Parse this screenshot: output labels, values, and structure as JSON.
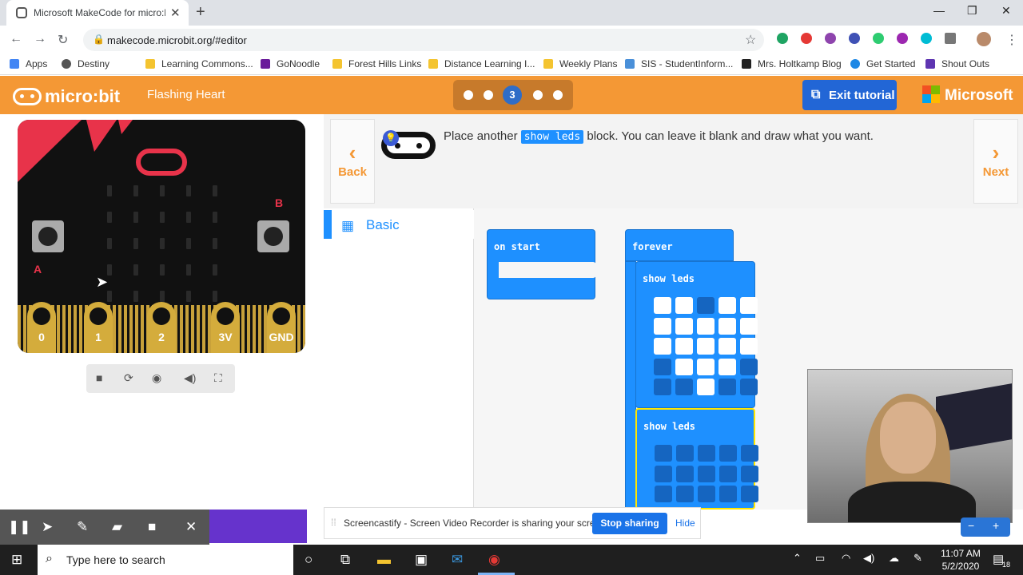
{
  "browser": {
    "tab_title": "Microsoft MakeCode for micro:bit",
    "url": "makecode.microbit.org/#editor",
    "bookmarks": [
      "Apps",
      "Destiny",
      "Learning Commons...",
      "GoNoodle",
      "Forest Hills Links",
      "Distance Learning I...",
      "Weekly Plans",
      "SIS - StudentInform...",
      "Mrs. Holtkamp Blog",
      "Get Started",
      "Shout Outs"
    ]
  },
  "header": {
    "logo": "micro:bit",
    "project_name": "Flashing Heart",
    "current_step": "3",
    "exit_label": "Exit tutorial",
    "brand": "Microsoft"
  },
  "tutorial": {
    "text_before": "Place another ",
    "code_chip": "show leds",
    "text_after": " block. You can leave it blank and draw what you want.",
    "back_label": "Back",
    "next_label": "Next"
  },
  "simulator": {
    "button_a": "A",
    "button_b": "B",
    "pins": [
      "0",
      "1",
      "2",
      "3V",
      "GND"
    ]
  },
  "toolbox": {
    "category": "Basic"
  },
  "blocks": {
    "on_start": "on start",
    "forever": "forever",
    "show_leds_1": "show leds",
    "show_leds_2": "show leds",
    "leds_1": [
      [
        1,
        1,
        0,
        1,
        1
      ],
      [
        1,
        1,
        1,
        1,
        1
      ],
      [
        1,
        1,
        1,
        1,
        1
      ],
      [
        0,
        1,
        1,
        1,
        0
      ],
      [
        0,
        0,
        1,
        0,
        0
      ]
    ]
  },
  "screencast": {
    "message": "Screencastify - Screen Video Recorder is sharing your screen.",
    "stop_label": "Stop sharing",
    "hide_label": "Hide"
  },
  "taskbar": {
    "search_placeholder": "Type here to search",
    "time": "11:07 AM",
    "date": "5/2/2020",
    "notif_count": "18"
  }
}
